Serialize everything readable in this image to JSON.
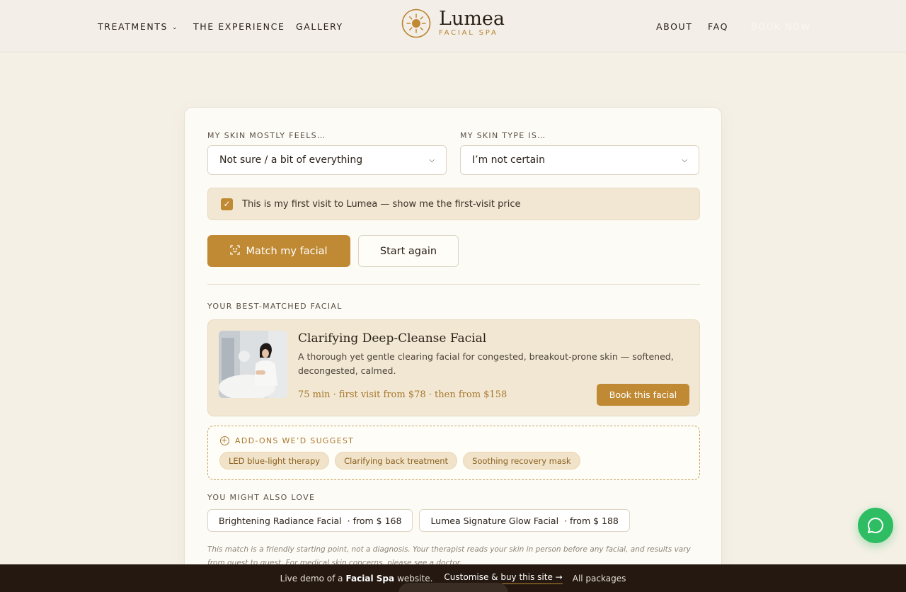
{
  "header": {
    "nav_left": [
      {
        "label": "TREATMENTS",
        "has_dropdown": true
      },
      {
        "label": "THE EXPERIENCE"
      },
      {
        "label": "GALLERY"
      }
    ],
    "logo": {
      "name": "Lumea",
      "tagline": "FACIAL SPA",
      "icon": "sun-icon"
    },
    "nav_right": [
      {
        "label": "ABOUT"
      },
      {
        "label": "FAQ"
      },
      {
        "label": "BOOK NOW"
      }
    ]
  },
  "form": {
    "skin_feel": {
      "label": "MY SKIN MOSTLY FEELS…",
      "value": "Not sure / a bit of everything"
    },
    "skin_type": {
      "label": "MY SKIN TYPE IS…",
      "value": "I’m not certain"
    },
    "first_visit": {
      "checked": true,
      "label": "This is my first visit to Lumea — show me the first-visit price"
    },
    "match_button": "Match my facial",
    "reset_button": "Start again"
  },
  "result": {
    "heading": "YOUR BEST-MATCHED FACIAL",
    "title": "Clarifying Deep-Cleanse Facial",
    "description": "A thorough yet gentle clearing facial for congested, breakout-prone skin — softened, decongested, calmed.",
    "meta": "75 min · first visit from $78 · then from $158",
    "book_button": "Book this facial"
  },
  "addons": {
    "heading": "ADD-ONS WE’D SUGGEST",
    "items": [
      "LED blue-light therapy",
      "Clarifying back treatment",
      "Soothing recovery mask"
    ]
  },
  "also_love": {
    "heading": "YOU MIGHT ALSO LOVE",
    "items": [
      {
        "name": "Brightening Radiance Facial",
        "price": "· from $  168"
      },
      {
        "name": "Lumea Signature Glow Facial",
        "price": "· from $  188"
      }
    ]
  },
  "disclaimer": "This match is a friendly starting point, not a diagnosis. Your therapist reads your skin in person before any facial, and results vary from guest to guest. For medical skin concerns, please see a doctor.",
  "bottombar": {
    "prefix": "Live demo of a",
    "site_type": "Facial Spa",
    "suffix": "website.",
    "cta": "Customise & buy this site →",
    "packages": "All packages"
  },
  "colors": {
    "accent": "#c08a34",
    "background": "#f5f0e6",
    "card": "#fdfbf5",
    "chat": "#2ebd62",
    "bottombar": "#241811"
  }
}
